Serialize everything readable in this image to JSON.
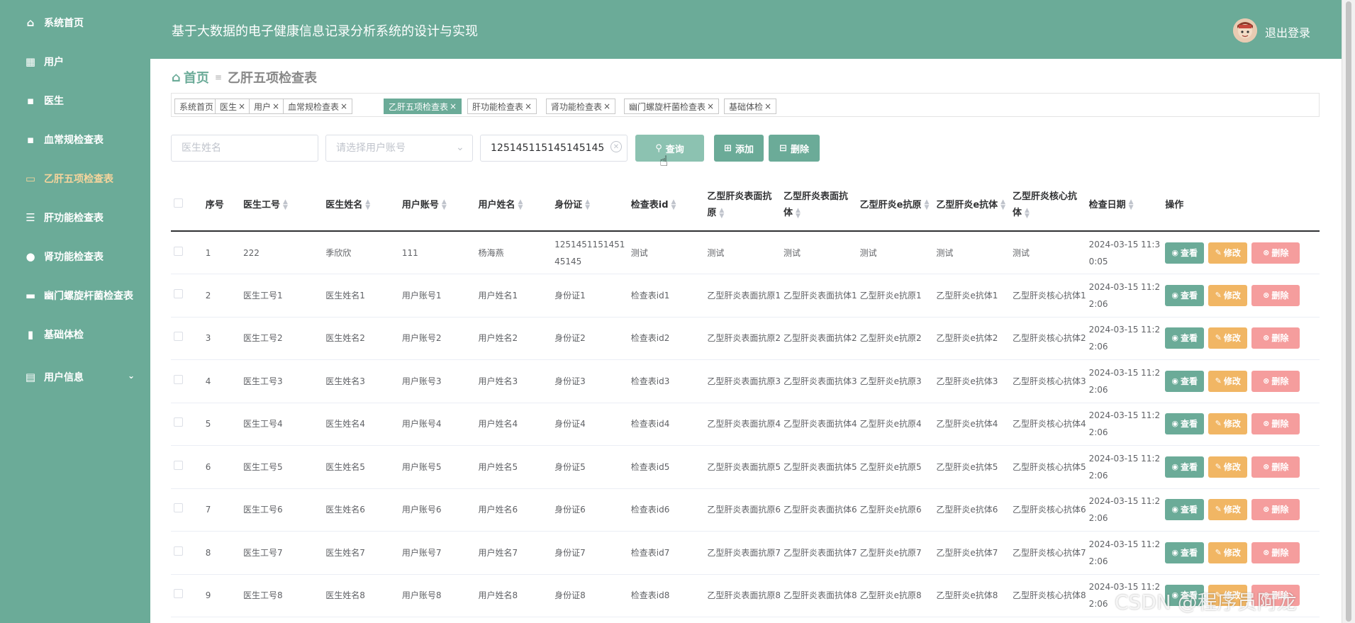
{
  "sidebar": {
    "items": [
      {
        "label": "系统首页",
        "icon": "home-icon",
        "glyph": "⌂"
      },
      {
        "label": "用户",
        "icon": "grid-icon",
        "glyph": "▦"
      },
      {
        "label": "医生",
        "icon": "apps-icon",
        "glyph": "▪"
      },
      {
        "label": "血常规检查表",
        "icon": "apps-icon",
        "glyph": "▪"
      },
      {
        "label": "乙肝五项检查表",
        "icon": "briefcase-icon",
        "glyph": "▭"
      },
      {
        "label": "肝功能检查表",
        "icon": "sliders-icon",
        "glyph": "☰"
      },
      {
        "label": "肾功能检查表",
        "icon": "user-icon",
        "glyph": "●"
      },
      {
        "label": "幽门螺旋杆菌检查表",
        "icon": "card-icon",
        "glyph": "▬"
      },
      {
        "label": "基础体检",
        "icon": "chart-icon",
        "glyph": "▮"
      },
      {
        "label": "用户信息",
        "icon": "id-card-icon",
        "glyph": "▤"
      }
    ],
    "active_index": 4,
    "active_color": "#f5d49c"
  },
  "header": {
    "title": "基于大数据的电子健康信息记录分析系统的设计与实现",
    "logout": "退出登录"
  },
  "breadcrumb": {
    "home": "首页",
    "separator": "≡",
    "current": "乙肝五项检查表"
  },
  "tags": [
    {
      "label": "系统首页",
      "closable": false,
      "active": false
    },
    {
      "label": "医生",
      "closable": true,
      "active": false
    },
    {
      "label": "用户",
      "closable": true,
      "active": false
    },
    {
      "label": "血常规检查表",
      "closable": true,
      "active": false
    },
    {
      "label": "乙肝五项检查表",
      "closable": true,
      "active": true
    },
    {
      "label": "肝功能检查表",
      "closable": true,
      "active": false
    },
    {
      "label": "肾功能检查表",
      "closable": true,
      "active": false
    },
    {
      "label": "幽门螺旋杆菌检查表",
      "closable": true,
      "active": false
    },
    {
      "label": "基础体检",
      "closable": true,
      "active": false
    }
  ],
  "search": {
    "doctor_name_placeholder": "医生姓名",
    "user_account_placeholder": "请选择用户账号",
    "id_value": "125145115145145145",
    "query_label": "查询",
    "add_label": "添加",
    "delete_label": "删除"
  },
  "table": {
    "columns": [
      "序号",
      "医生工号",
      "医生姓名",
      "用户账号",
      "用户姓名",
      "身份证",
      "检查表id",
      "乙型肝炎表面抗原",
      "乙型肝炎表面抗体",
      "乙型肝炎e抗原",
      "乙型肝炎e抗体",
      "乙型肝炎核心抗体",
      "检查日期",
      "操作"
    ],
    "rows": [
      [
        "1",
        "222",
        "季欣欣",
        "111",
        "杨海燕",
        "125145115145145145",
        "测试",
        "测试",
        "测试",
        "测试",
        "测试",
        "测试",
        "2024-03-15 11:30:05"
      ],
      [
        "2",
        "医生工号1",
        "医生姓名1",
        "用户账号1",
        "用户姓名1",
        "身份证1",
        "检查表id1",
        "乙型肝炎表面抗原1",
        "乙型肝炎表面抗体1",
        "乙型肝炎e抗原1",
        "乙型肝炎e抗体1",
        "乙型肝炎核心抗体1",
        "2024-03-15 11:22:06"
      ],
      [
        "3",
        "医生工号2",
        "医生姓名2",
        "用户账号2",
        "用户姓名2",
        "身份证2",
        "检查表id2",
        "乙型肝炎表面抗原2",
        "乙型肝炎表面抗体2",
        "乙型肝炎e抗原2",
        "乙型肝炎e抗体2",
        "乙型肝炎核心抗体2",
        "2024-03-15 11:22:06"
      ],
      [
        "4",
        "医生工号3",
        "医生姓名3",
        "用户账号3",
        "用户姓名3",
        "身份证3",
        "检查表id3",
        "乙型肝炎表面抗原3",
        "乙型肝炎表面抗体3",
        "乙型肝炎e抗原3",
        "乙型肝炎e抗体3",
        "乙型肝炎核心抗体3",
        "2024-03-15 11:22:06"
      ],
      [
        "5",
        "医生工号4",
        "医生姓名4",
        "用户账号4",
        "用户姓名4",
        "身份证4",
        "检查表id4",
        "乙型肝炎表面抗原4",
        "乙型肝炎表面抗体4",
        "乙型肝炎e抗原4",
        "乙型肝炎e抗体4",
        "乙型肝炎核心抗体4",
        "2024-03-15 11:22:06"
      ],
      [
        "6",
        "医生工号5",
        "医生姓名5",
        "用户账号5",
        "用户姓名5",
        "身份证5",
        "检查表id5",
        "乙型肝炎表面抗原5",
        "乙型肝炎表面抗体5",
        "乙型肝炎e抗原5",
        "乙型肝炎e抗体5",
        "乙型肝炎核心抗体5",
        "2024-03-15 11:22:06"
      ],
      [
        "7",
        "医生工号6",
        "医生姓名6",
        "用户账号6",
        "用户姓名6",
        "身份证6",
        "检查表id6",
        "乙型肝炎表面抗原6",
        "乙型肝炎表面抗体6",
        "乙型肝炎e抗原6",
        "乙型肝炎e抗体6",
        "乙型肝炎核心抗体6",
        "2024-03-15 11:22:06"
      ],
      [
        "8",
        "医生工号7",
        "医生姓名7",
        "用户账号7",
        "用户姓名7",
        "身份证7",
        "检查表id7",
        "乙型肝炎表面抗原7",
        "乙型肝炎表面抗体7",
        "乙型肝炎e抗原7",
        "乙型肝炎e抗体7",
        "乙型肝炎核心抗体7",
        "2024-03-15 11:22:06"
      ],
      [
        "9",
        "医生工号8",
        "医生姓名8",
        "用户账号8",
        "用户姓名8",
        "身份证8",
        "检查表id8",
        "乙型肝炎表面抗原8",
        "乙型肝炎表面抗体8",
        "乙型肝炎e抗原8",
        "乙型肝炎e抗体8",
        "乙型肝炎核心抗体8",
        "2024-03-15 11:22:06"
      ]
    ],
    "actions": {
      "view": "查看",
      "edit": "修改",
      "delete": "删除"
    }
  },
  "watermark": "CSDN @程序员阿龙",
  "colors": {
    "primary": "#6bab98",
    "edit": "#f1b664",
    "delete": "#f59d9d",
    "active_nav": "#f5d49c"
  }
}
